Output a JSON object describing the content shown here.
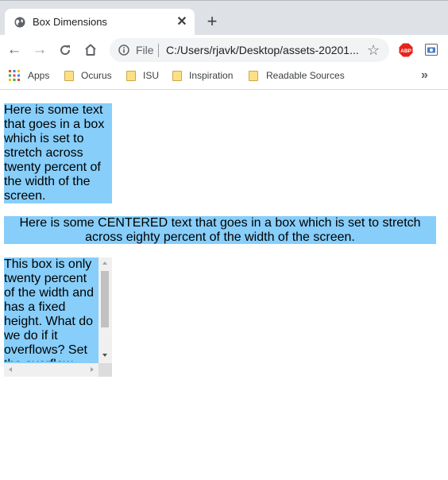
{
  "browser": {
    "tab_title": "Box Dimensions",
    "new_tab_label": "+",
    "close_label": "✕",
    "file_label": "File",
    "url": "C:/Users/rjavk/Desktop/assets-20201...",
    "abp_label": "ABP"
  },
  "bookmarks": [
    {
      "label": "Apps",
      "icon": "apps-grid-icon"
    },
    {
      "label": "Ocurus",
      "icon": "folder-icon"
    },
    {
      "label": "ISU",
      "icon": "folder-icon"
    },
    {
      "label": "Inspiration",
      "icon": "folder-icon"
    },
    {
      "label": "Readable Sources",
      "icon": "folder-icon"
    }
  ],
  "bookmarks_overflow": "»",
  "content": {
    "box1": "Here is some text that goes in a box which is set to stretch across twenty percent of the width of the screen.",
    "box2": "Here is some CENTERED text that goes in a box which is set to stretch across eighty percent of the width of the screen.",
    "box3": "This box is only twenty percent of the width and has a fixed height. What do we do if it overflows? Set the overflow property to scroll."
  },
  "colors": {
    "box_background": "#87cefa",
    "tabstrip": "#dee1e6"
  }
}
